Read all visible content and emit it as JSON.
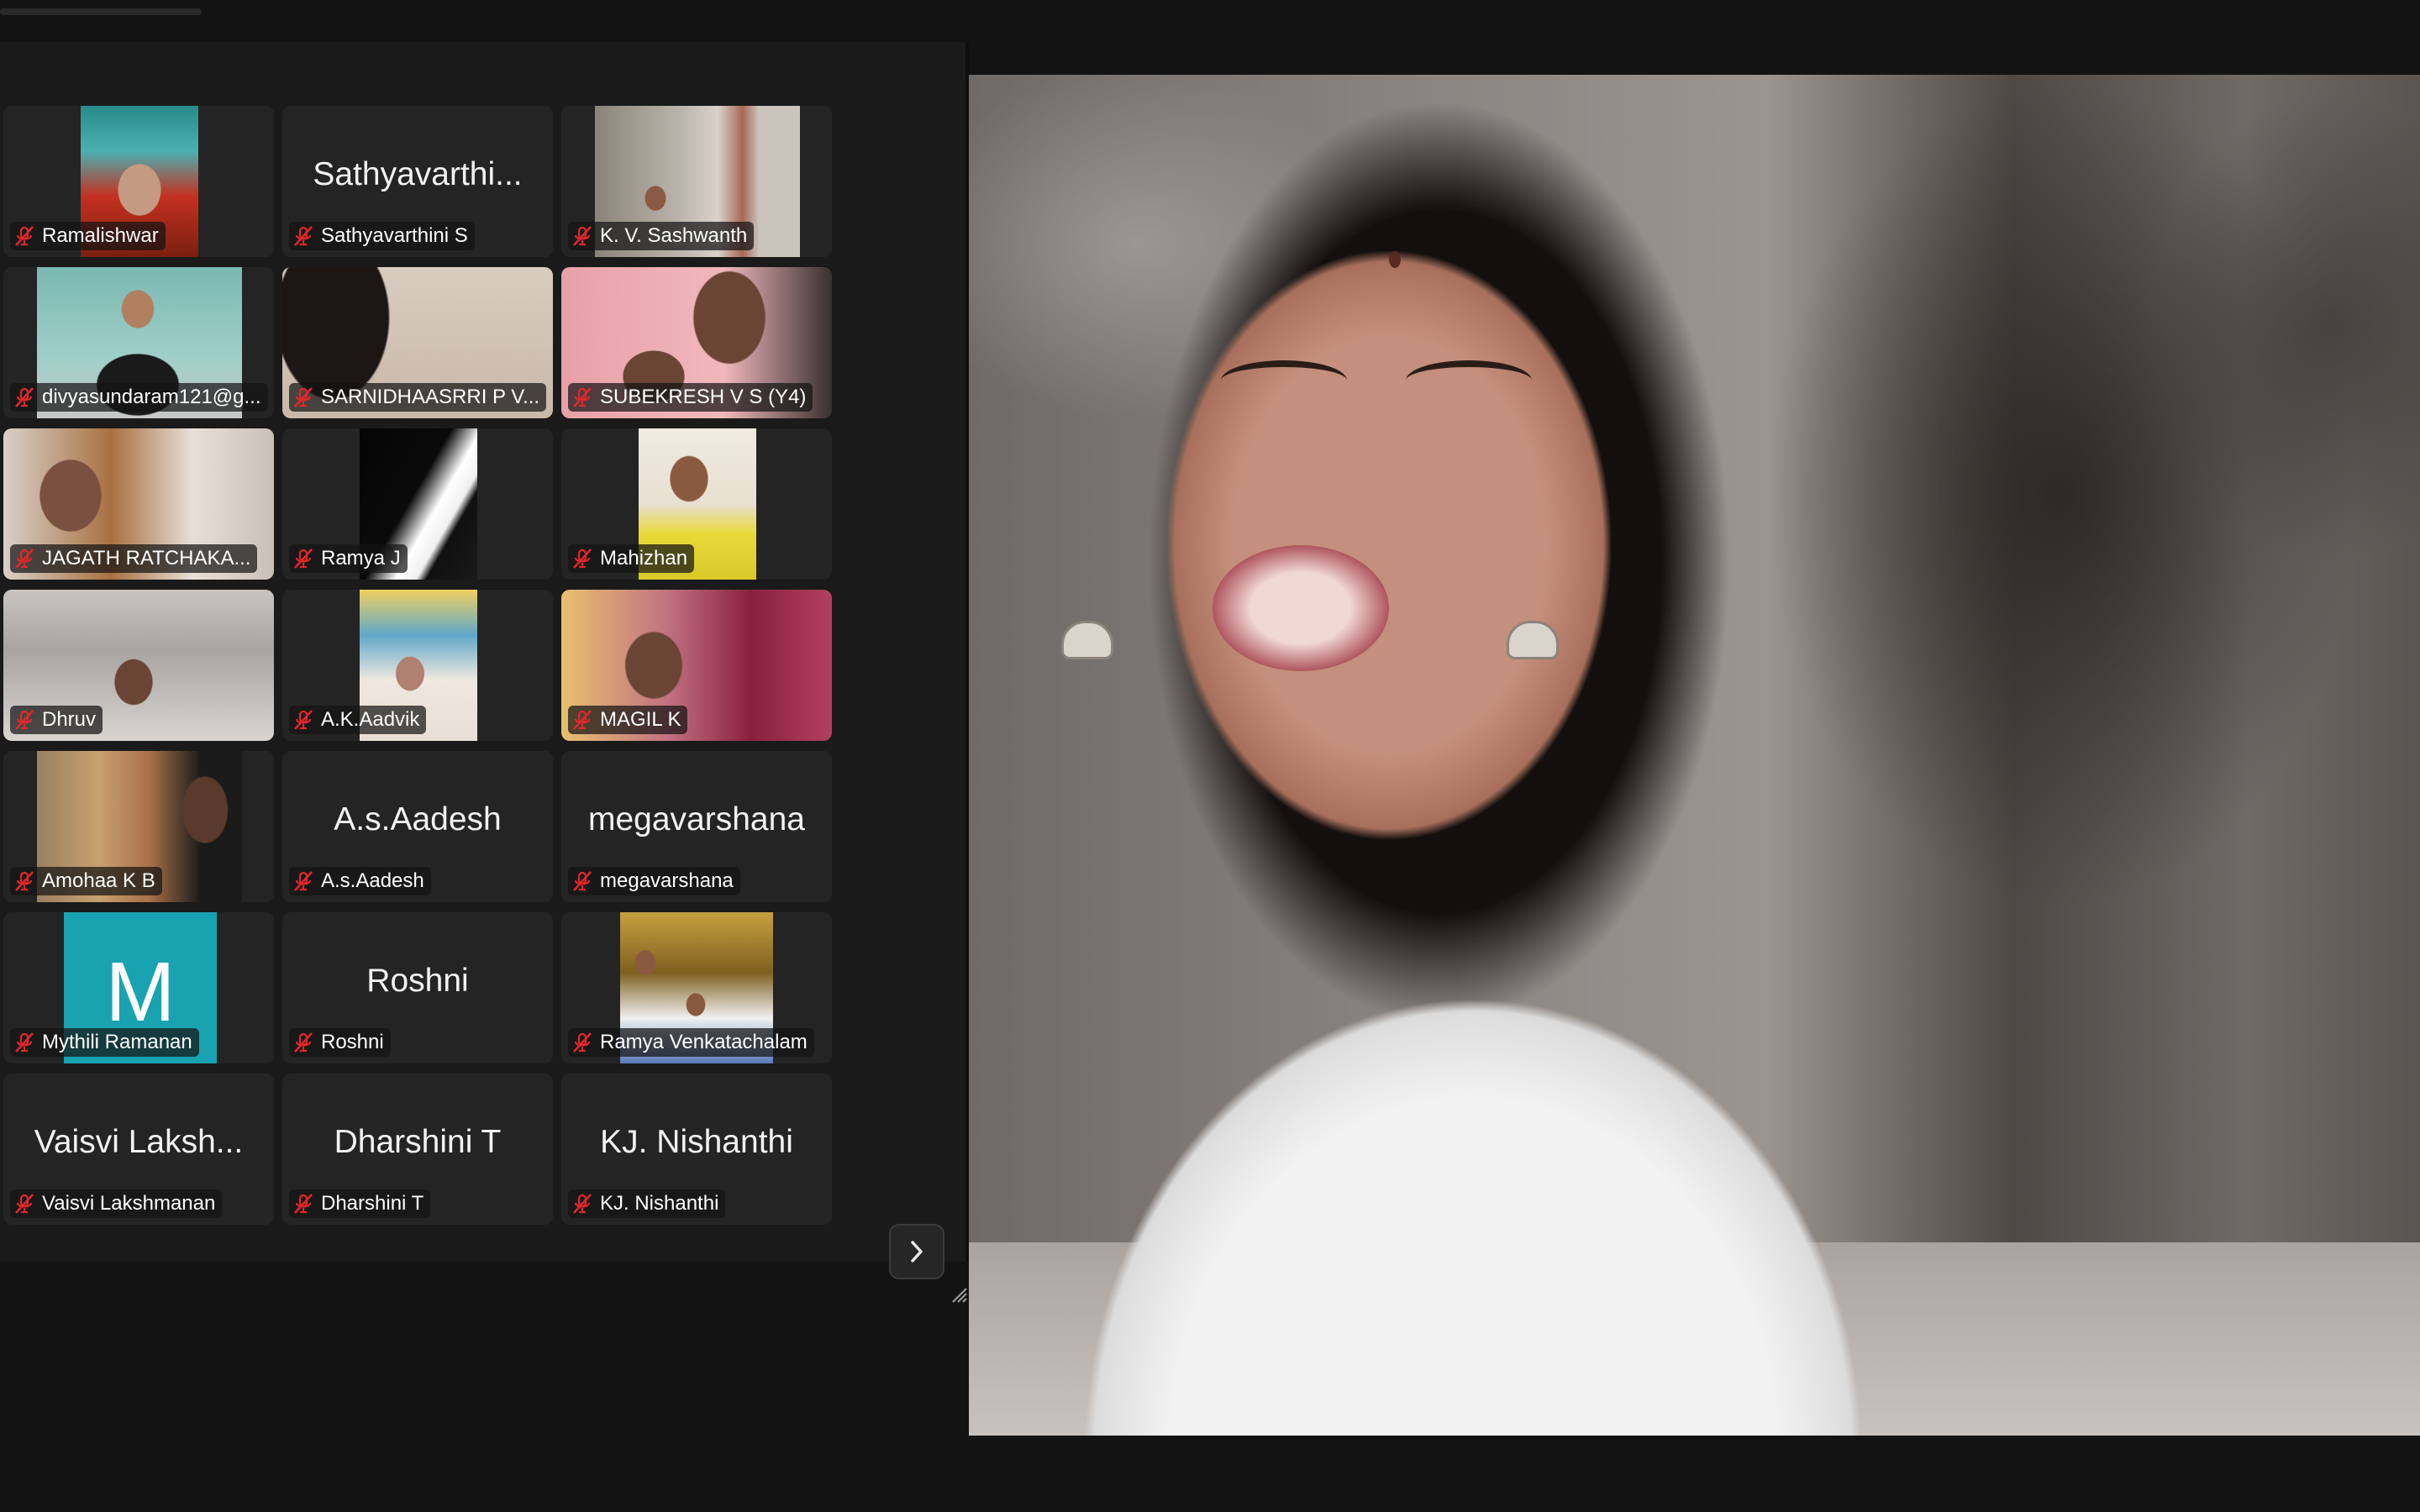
{
  "participants": [
    {
      "display_name": "Ramalishwar",
      "big_name": "",
      "muted": true,
      "video": "v1"
    },
    {
      "display_name": "Sathyavarthini S",
      "big_name": "Sathyavarthi...",
      "muted": true,
      "video": ""
    },
    {
      "display_name": "K. V. Sashwanth",
      "big_name": "",
      "muted": true,
      "video": "v3"
    },
    {
      "display_name": "divyasundaram121@g...",
      "big_name": "",
      "muted": true,
      "video": "v4"
    },
    {
      "display_name": "SARNIDHAASRRI P V...",
      "big_name": "",
      "muted": true,
      "video": "v5"
    },
    {
      "display_name": "SUBEKRESH V S (Y4)",
      "big_name": "",
      "muted": true,
      "video": "v6"
    },
    {
      "display_name": "JAGATH RATCHAKA...",
      "big_name": "",
      "muted": true,
      "video": "v7"
    },
    {
      "display_name": "Ramya J",
      "big_name": "",
      "muted": true,
      "video": "v8"
    },
    {
      "display_name": "Mahizhan",
      "big_name": "",
      "muted": true,
      "video": "v9"
    },
    {
      "display_name": "Dhruv",
      "big_name": "",
      "muted": true,
      "video": "v10"
    },
    {
      "display_name": "A.K.Aadvik",
      "big_name": "",
      "muted": true,
      "video": "v11"
    },
    {
      "display_name": "MAGIL K",
      "big_name": "",
      "muted": true,
      "video": "v12"
    },
    {
      "display_name": "Amohaa K B",
      "big_name": "",
      "muted": true,
      "video": "v13"
    },
    {
      "display_name": "A.s.Aadesh",
      "big_name": "A.s.Aadesh",
      "muted": true,
      "video": ""
    },
    {
      "display_name": "megavarshana",
      "big_name": "megavarshana",
      "muted": true,
      "video": ""
    },
    {
      "display_name": "Mythili Ramanan",
      "big_name": "",
      "avatar_letter": "M",
      "muted": true,
      "video": "avatar"
    },
    {
      "display_name": "Roshni",
      "big_name": "Roshni",
      "muted": true,
      "video": ""
    },
    {
      "display_name": "Ramya Venkatachalam",
      "big_name": "",
      "muted": true,
      "video": "v18"
    },
    {
      "display_name": "Vaisvi Lakshmanan",
      "big_name": "Vaisvi Laksh...",
      "muted": true,
      "video": ""
    },
    {
      "display_name": "Dharshini T",
      "big_name": "Dharshini T",
      "muted": true,
      "video": ""
    },
    {
      "display_name": "KJ. Nishanthi",
      "big_name": "KJ. Nishanthi",
      "muted": true,
      "video": ""
    }
  ],
  "controls": {
    "next_page_icon": "chevron-right-icon",
    "mic_icon": "mic-muted-icon"
  },
  "colors": {
    "muted_red": "#e0272b",
    "avatar_teal": "#19a2b0",
    "tile_bg": "#242424",
    "app_bg": "#131313"
  }
}
